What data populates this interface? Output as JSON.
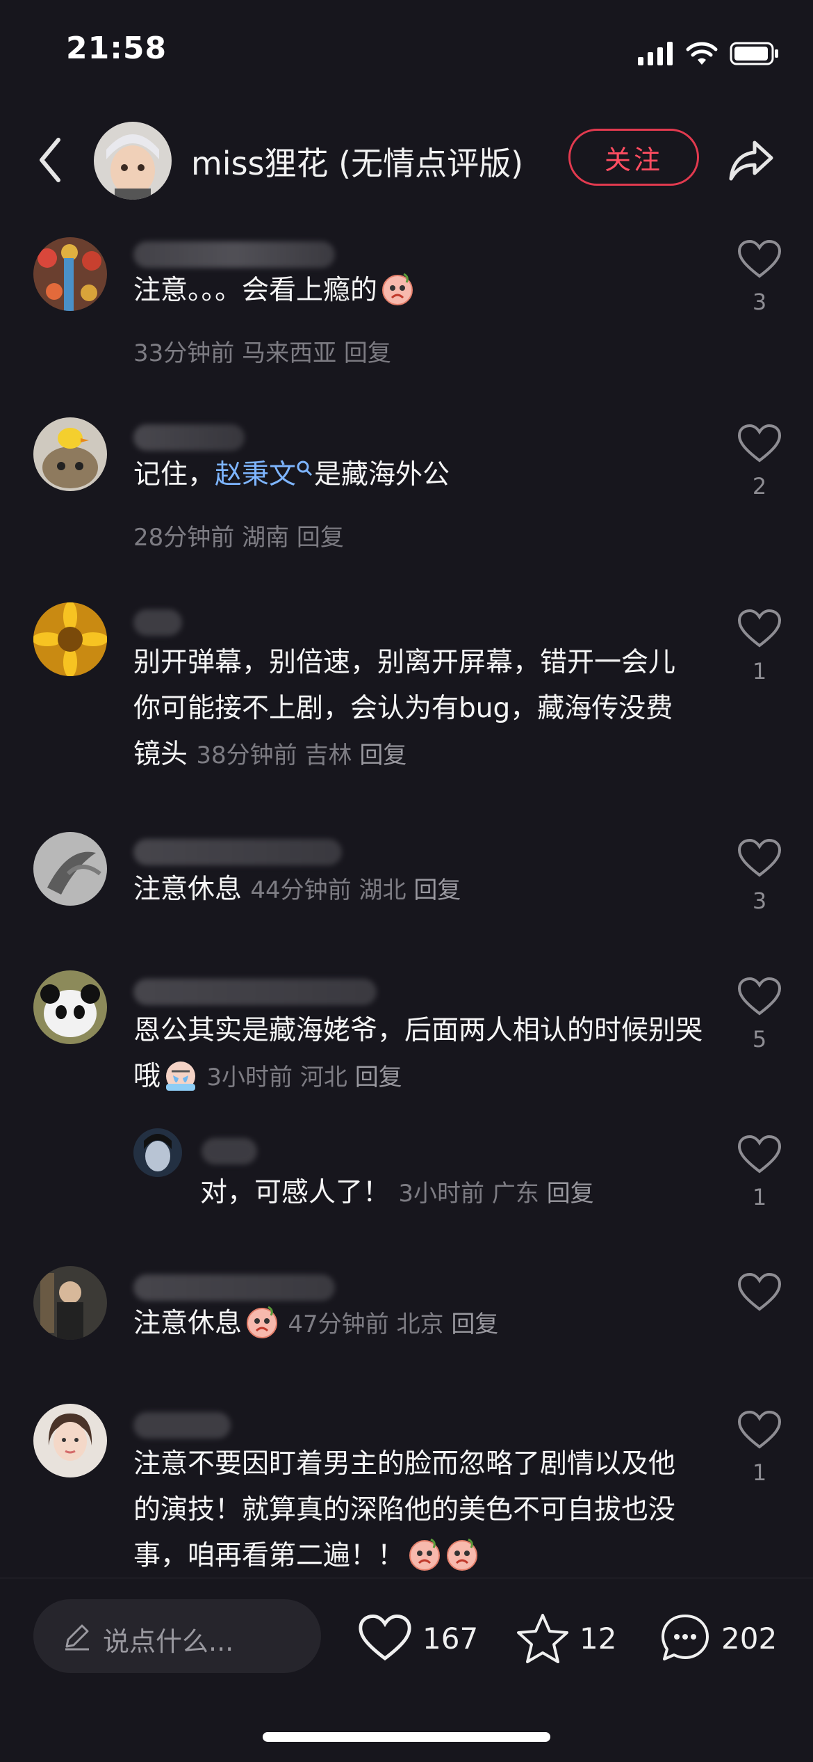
{
  "status": {
    "time": "21:58"
  },
  "header": {
    "title": "miss狸花 (无情点评版)",
    "follow_label": "关注"
  },
  "comments": [
    {
      "text": "注意。。。会看上瘾的",
      "time": "33分钟前",
      "location": "马来西亚",
      "reply_label": "回复",
      "likes": "3"
    },
    {
      "text_before": "记住，",
      "link": "赵秉文",
      "text_after": "是藏海外公",
      "time": "28分钟前",
      "location": "湖南",
      "reply_label": "回复",
      "likes": "2"
    },
    {
      "text": "别开弹幕，别倍速，别离开屏幕，错开一会儿你可能接不上剧，会认为有bug，藏海传没费镜头",
      "time": "38分钟前",
      "location": "吉林",
      "reply_label": "回复",
      "likes": "1"
    },
    {
      "text": "注意休息",
      "time": "44分钟前",
      "location": "湖北",
      "reply_label": "回复",
      "likes": "3"
    },
    {
      "text": "恩公其实是藏海姥爷，后面两人相认的时候别哭哦",
      "time": "3小时前",
      "location": "河北",
      "reply_label": "回复",
      "likes": "5"
    },
    {
      "text": "对，可感人了！",
      "time": "3小时前",
      "location": "广东",
      "reply_label": "回复",
      "likes": "1"
    },
    {
      "text": "注意休息",
      "time": "47分钟前",
      "location": "北京",
      "reply_label": "回复",
      "likes": ""
    },
    {
      "text": "注意不要因盯着男主的脸而忽略了剧情以及他的演技！就算真的深陷他的美色不可自拔也没事，咱再看第二遍！！",
      "likes": "1"
    }
  ],
  "bottom": {
    "input_placeholder": "说点什么...",
    "likes": "167",
    "favorites": "12",
    "comments": "202"
  },
  "colors": {
    "background": "#17161d",
    "accent": "#e23a4f",
    "link": "#7eb5ff"
  },
  "icons": [
    "back-arrow-icon",
    "share-icon",
    "heart-icon",
    "star-icon",
    "comment-bubble-icon",
    "pencil-icon",
    "search-icon",
    "emoji-icon"
  ]
}
